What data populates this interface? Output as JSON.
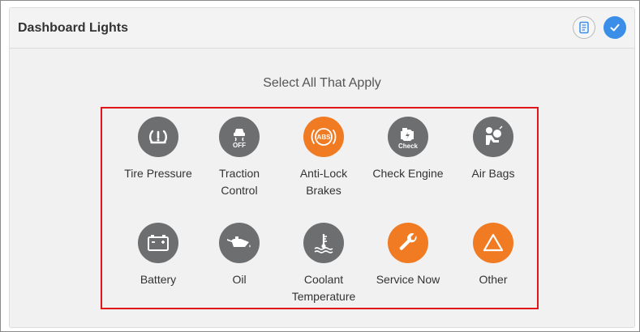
{
  "header": {
    "title": "Dashboard Lights",
    "notes_icon": "notes-icon",
    "confirm_icon": "checkmark-icon"
  },
  "prompt": "Select All That Apply",
  "colors": {
    "icon_default": "#6c6e70",
    "icon_selected": "#f07b22",
    "highlight_border": "#e0161b",
    "confirm_button": "#3a8ee8"
  },
  "options": [
    {
      "line1": "Tire Pressure",
      "line2": "",
      "icon": "tire-pressure-icon",
      "icon_text": "",
      "selected": false
    },
    {
      "line1": "Traction",
      "line2": "Control",
      "icon": "traction-control-off-icon",
      "icon_text": "OFF",
      "selected": false
    },
    {
      "line1": "Anti-Lock",
      "line2": "Brakes",
      "icon": "abs-icon",
      "icon_text": "ABS",
      "selected": true
    },
    {
      "line1": "Check Engine",
      "line2": "",
      "icon": "check-engine-icon",
      "icon_text": "Check",
      "selected": false
    },
    {
      "line1": "Air Bags",
      "line2": "",
      "icon": "air-bag-icon",
      "icon_text": "",
      "selected": false
    },
    {
      "line1": "Battery",
      "line2": "",
      "icon": "battery-icon",
      "icon_text": "",
      "selected": false
    },
    {
      "line1": "Oil",
      "line2": "",
      "icon": "oil-can-icon",
      "icon_text": "",
      "selected": false
    },
    {
      "line1": "Coolant",
      "line2": "Temperature",
      "icon": "coolant-temperature-icon",
      "icon_text": "",
      "selected": false
    },
    {
      "line1": "Service Now",
      "line2": "",
      "icon": "wrench-icon",
      "icon_text": "",
      "selected": true
    },
    {
      "line1": "Other",
      "line2": "",
      "icon": "warning-triangle-icon",
      "icon_text": "",
      "selected": true
    }
  ]
}
